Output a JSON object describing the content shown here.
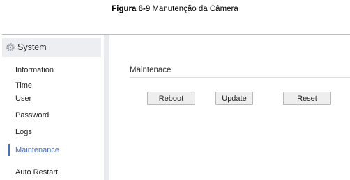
{
  "caption": {
    "figure_label": "Figura 6-9",
    "figure_title": "Manutenção da Câmera"
  },
  "sidebar": {
    "header_icon": "gear-icon",
    "header_title": "System",
    "items": [
      {
        "label": "Information"
      },
      {
        "label": "Time"
      },
      {
        "label": "User"
      },
      {
        "label": "Password"
      },
      {
        "label": "Logs"
      },
      {
        "label": "Maintenance",
        "active": true
      },
      {
        "label": "Auto Restart"
      }
    ]
  },
  "main": {
    "section_title": "Maintenace",
    "buttons": {
      "reboot": "Reboot",
      "update": "Update",
      "reset": "Reset"
    }
  },
  "colors": {
    "accent": "#4a6fbf",
    "sidebar_header_bg": "#edeef2",
    "divider": "#e9ebef"
  }
}
